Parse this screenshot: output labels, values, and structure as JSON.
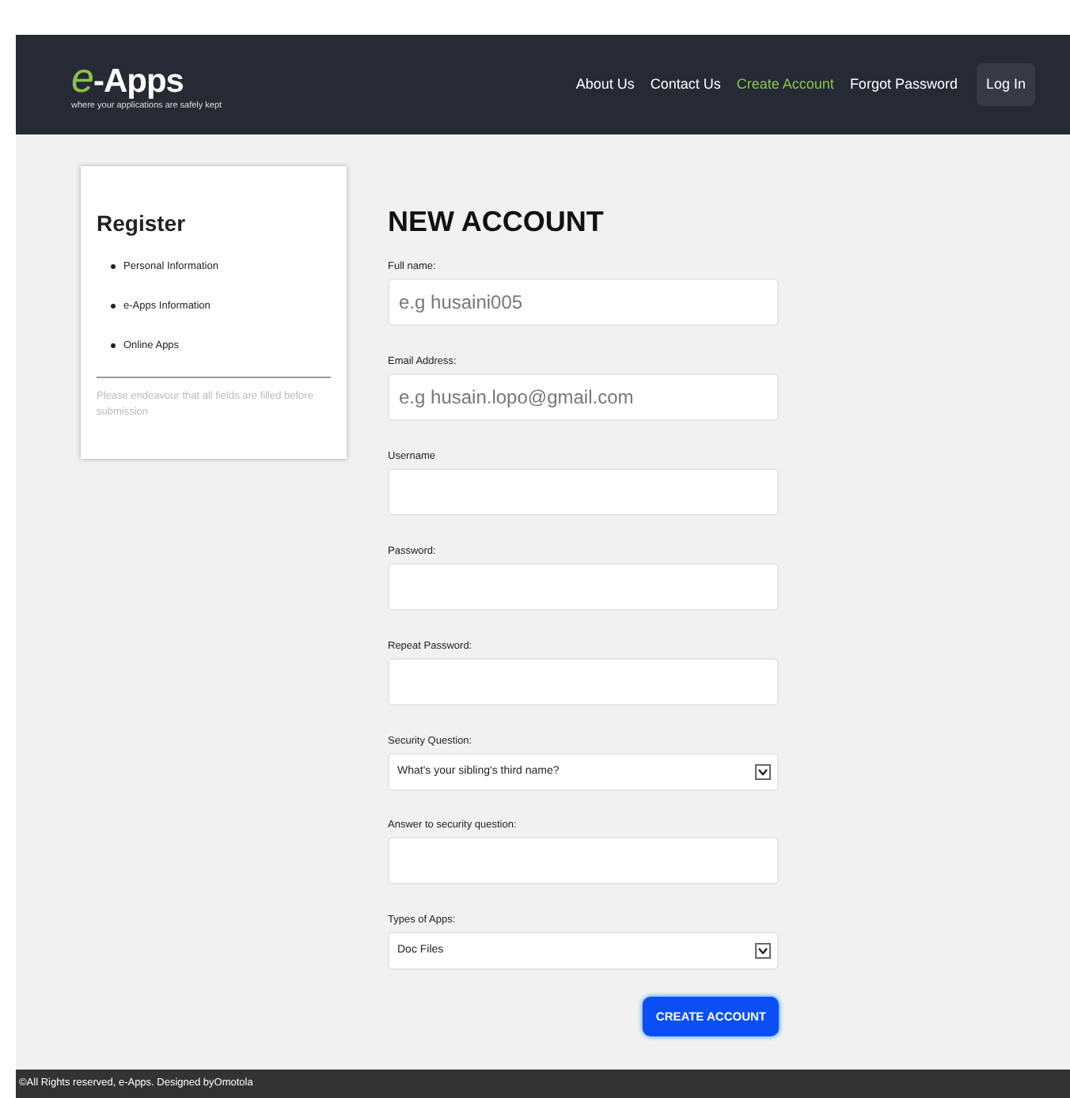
{
  "header": {
    "logo_mark": "e",
    "logo_rest": "-Apps",
    "tagline": "where your applications are safely kept",
    "nav": [
      {
        "label": "About Us",
        "selected": false
      },
      {
        "label": "Contact Us",
        "selected": false
      },
      {
        "label": "Create Account",
        "selected": true
      },
      {
        "label": "Forgot Password",
        "selected": false
      }
    ],
    "login_button": "Log In"
  },
  "sidebar": {
    "title": "Register",
    "items": [
      "Personal Information",
      "e-Apps Information",
      "Online Apps"
    ],
    "note": "Please endeavour that all fields are filled before submission"
  },
  "form": {
    "title": "NEW ACCOUNT",
    "fields": [
      {
        "kind": "text",
        "label": "Full name:",
        "placeholder": "e.g husaini005"
      },
      {
        "kind": "text",
        "label": "Email Address:",
        "placeholder": "e.g husain.lopo@gmail.com"
      },
      {
        "kind": "text",
        "label": "Username"
      },
      {
        "kind": "password",
        "label": "Password:"
      },
      {
        "kind": "password",
        "label": "Repeat Password:"
      },
      {
        "kind": "select",
        "label": "Security Question:",
        "value": "What's your sibling's third name?"
      },
      {
        "kind": "text",
        "label": "Answer to security question:"
      },
      {
        "kind": "select",
        "label": "Types of Apps:",
        "value": "Doc Files"
      }
    ],
    "submit": "CREATE ACCOUNT"
  },
  "footer": "©All Rights reserved, e-Apps. Designed byOmotola"
}
